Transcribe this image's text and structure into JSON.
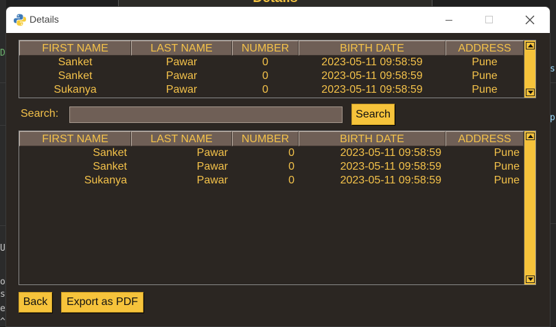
{
  "background": {
    "heading": "Details",
    "edge_chars_left": [
      "D",
      "U",
      "o",
      "s",
      "e",
      "^"
    ],
    "edge_chars_right": [
      "s",
      "p"
    ]
  },
  "window": {
    "title": "Details",
    "icon": "python-icon",
    "controls": {
      "minimize": "minimize-icon",
      "maximize": "maximize-icon",
      "close": "close-icon"
    }
  },
  "columns": [
    "FIRST NAME",
    "LAST NAME",
    "NUMBER",
    "BIRTH DATE",
    "ADDRESS"
  ],
  "table_top": {
    "rows": [
      [
        "Sanket",
        "Pawar",
        "0",
        "2023-05-11 09:58:59",
        "Pune"
      ],
      [
        "Sanket",
        "Pawar",
        "0",
        "2023-05-11 09:58:59",
        "Pune"
      ],
      [
        "Sukanya",
        "Pawar",
        "0",
        "2023-05-11 09:58:59",
        "Pune"
      ]
    ]
  },
  "search": {
    "label": "Search:",
    "value": "",
    "button": "Search"
  },
  "table_bottom": {
    "rows": [
      [
        "Sanket",
        "Pawar",
        "0",
        "2023-05-11 09:58:59",
        "Pune"
      ],
      [
        "Sanket",
        "Pawar",
        "0",
        "2023-05-11 09:58:59",
        "Pune"
      ],
      [
        "Sukanya",
        "Pawar",
        "0",
        "2023-05-11 09:58:59",
        "Pune"
      ]
    ]
  },
  "footer": {
    "back_label": "Back",
    "export_label": "Export as PDF"
  },
  "colors": {
    "window_bg": "#2b2622",
    "header_bg": "#6f5f56",
    "accent_text": "#f4c24a",
    "button_bg": "#f6c33b"
  }
}
